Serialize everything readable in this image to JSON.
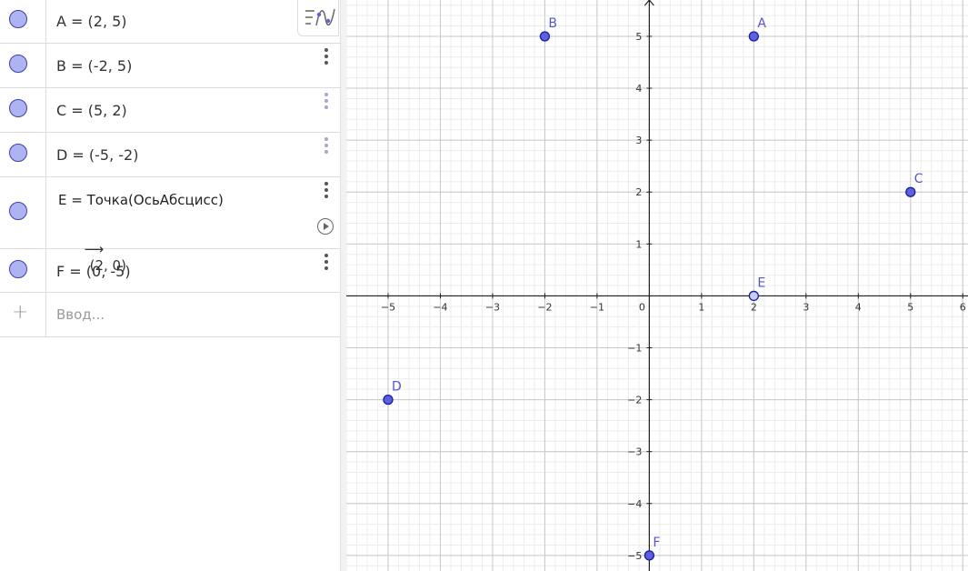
{
  "algebra": {
    "rows": [
      {
        "text": "A = (2, 5)"
      },
      {
        "text": "B = (-2, 5)"
      },
      {
        "text": "C = (5, 2)"
      },
      {
        "text": "D = (-5, -2)"
      },
      {
        "definition": "E = Точка(ОсьАбсцисс)",
        "arrow": "⟶",
        "value": "(2, 0)"
      },
      {
        "text": "F = (0, -5)"
      }
    ],
    "input_placeholder": "Ввод...",
    "plus": "+"
  },
  "colors": {
    "point_fill": "#5c61e0",
    "point_stroke": "#1a1aa0",
    "label": "#5555cc",
    "marble": "#aeb3f2"
  },
  "icons": {
    "view_toggle": "algebra-graph-toggle-icon",
    "menu": "kebab-menu-icon",
    "play": "play-circle-icon"
  },
  "graph": {
    "x_range": [
      -5.8,
      6.1
    ],
    "y_range": [
      -5.3,
      5.7
    ],
    "x_ticks": [
      "−5",
      "−4",
      "−3",
      "−2",
      "−1",
      "0",
      "1",
      "2",
      "3",
      "4",
      "5",
      "6"
    ],
    "y_ticks": [
      "−5",
      "−4",
      "−3",
      "−2",
      "−1",
      "1",
      "2",
      "3",
      "4",
      "5"
    ],
    "origin_label": "0",
    "points": [
      {
        "name": "A",
        "x": 2,
        "y": 5
      },
      {
        "name": "B",
        "x": -2,
        "y": 5
      },
      {
        "name": "C",
        "x": 5,
        "y": 2
      },
      {
        "name": "D",
        "x": -5,
        "y": -2
      },
      {
        "name": "E",
        "x": 2,
        "y": 0,
        "hollow": true
      },
      {
        "name": "F",
        "x": 0,
        "y": -5
      }
    ]
  }
}
